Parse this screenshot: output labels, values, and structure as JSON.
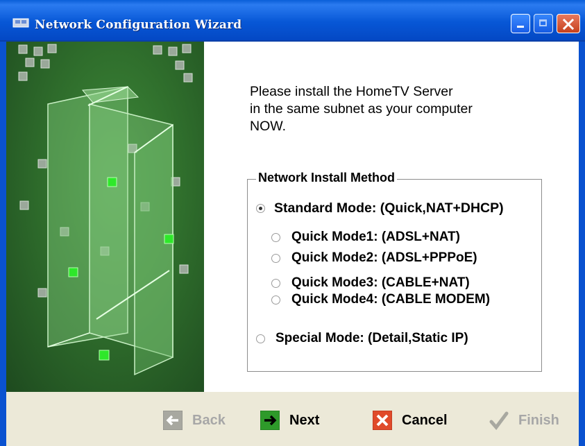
{
  "window": {
    "title": "Network Configuration Wizard",
    "controls": {
      "minimize": "minimize-icon",
      "maximize": "maximize-icon",
      "close": "close-icon"
    }
  },
  "content": {
    "instruction_lines": [
      "Please install the HomeTV Server",
      "in the same subnet as your computer",
      "NOW."
    ]
  },
  "method_group": {
    "legend": "Network Install Method",
    "selected": "Standard Mode: (Quick,NAT+DHCP)",
    "options": [
      {
        "label": "Standard Mode: (Quick,NAT+DHCP)",
        "checked": true
      },
      {
        "label": "Quick Mode1: (ADSL+NAT)",
        "checked": false
      },
      {
        "label": "Quick Mode2: (ADSL+PPPoE)",
        "checked": false
      },
      {
        "label": "Quick Mode3: (CABLE+NAT)",
        "checked": false
      },
      {
        "label": "Quick Mode4: (CABLE MODEM)",
        "checked": false
      },
      {
        "label": "Special Mode: (Detail,Static IP)",
        "checked": false
      }
    ]
  },
  "buttons": {
    "back": {
      "label": "Back",
      "enabled": false
    },
    "next": {
      "label": "Next",
      "enabled": true
    },
    "cancel": {
      "label": "Cancel",
      "enabled": true
    },
    "finish": {
      "label": "Finish",
      "enabled": false
    }
  },
  "colors": {
    "titlebar": "#0757d6",
    "side_panel": "#2f6e2c",
    "next_icon": "#2e9a2a",
    "cancel_icon": "#e04a2a",
    "disabled_text": "#a7a7a7"
  }
}
